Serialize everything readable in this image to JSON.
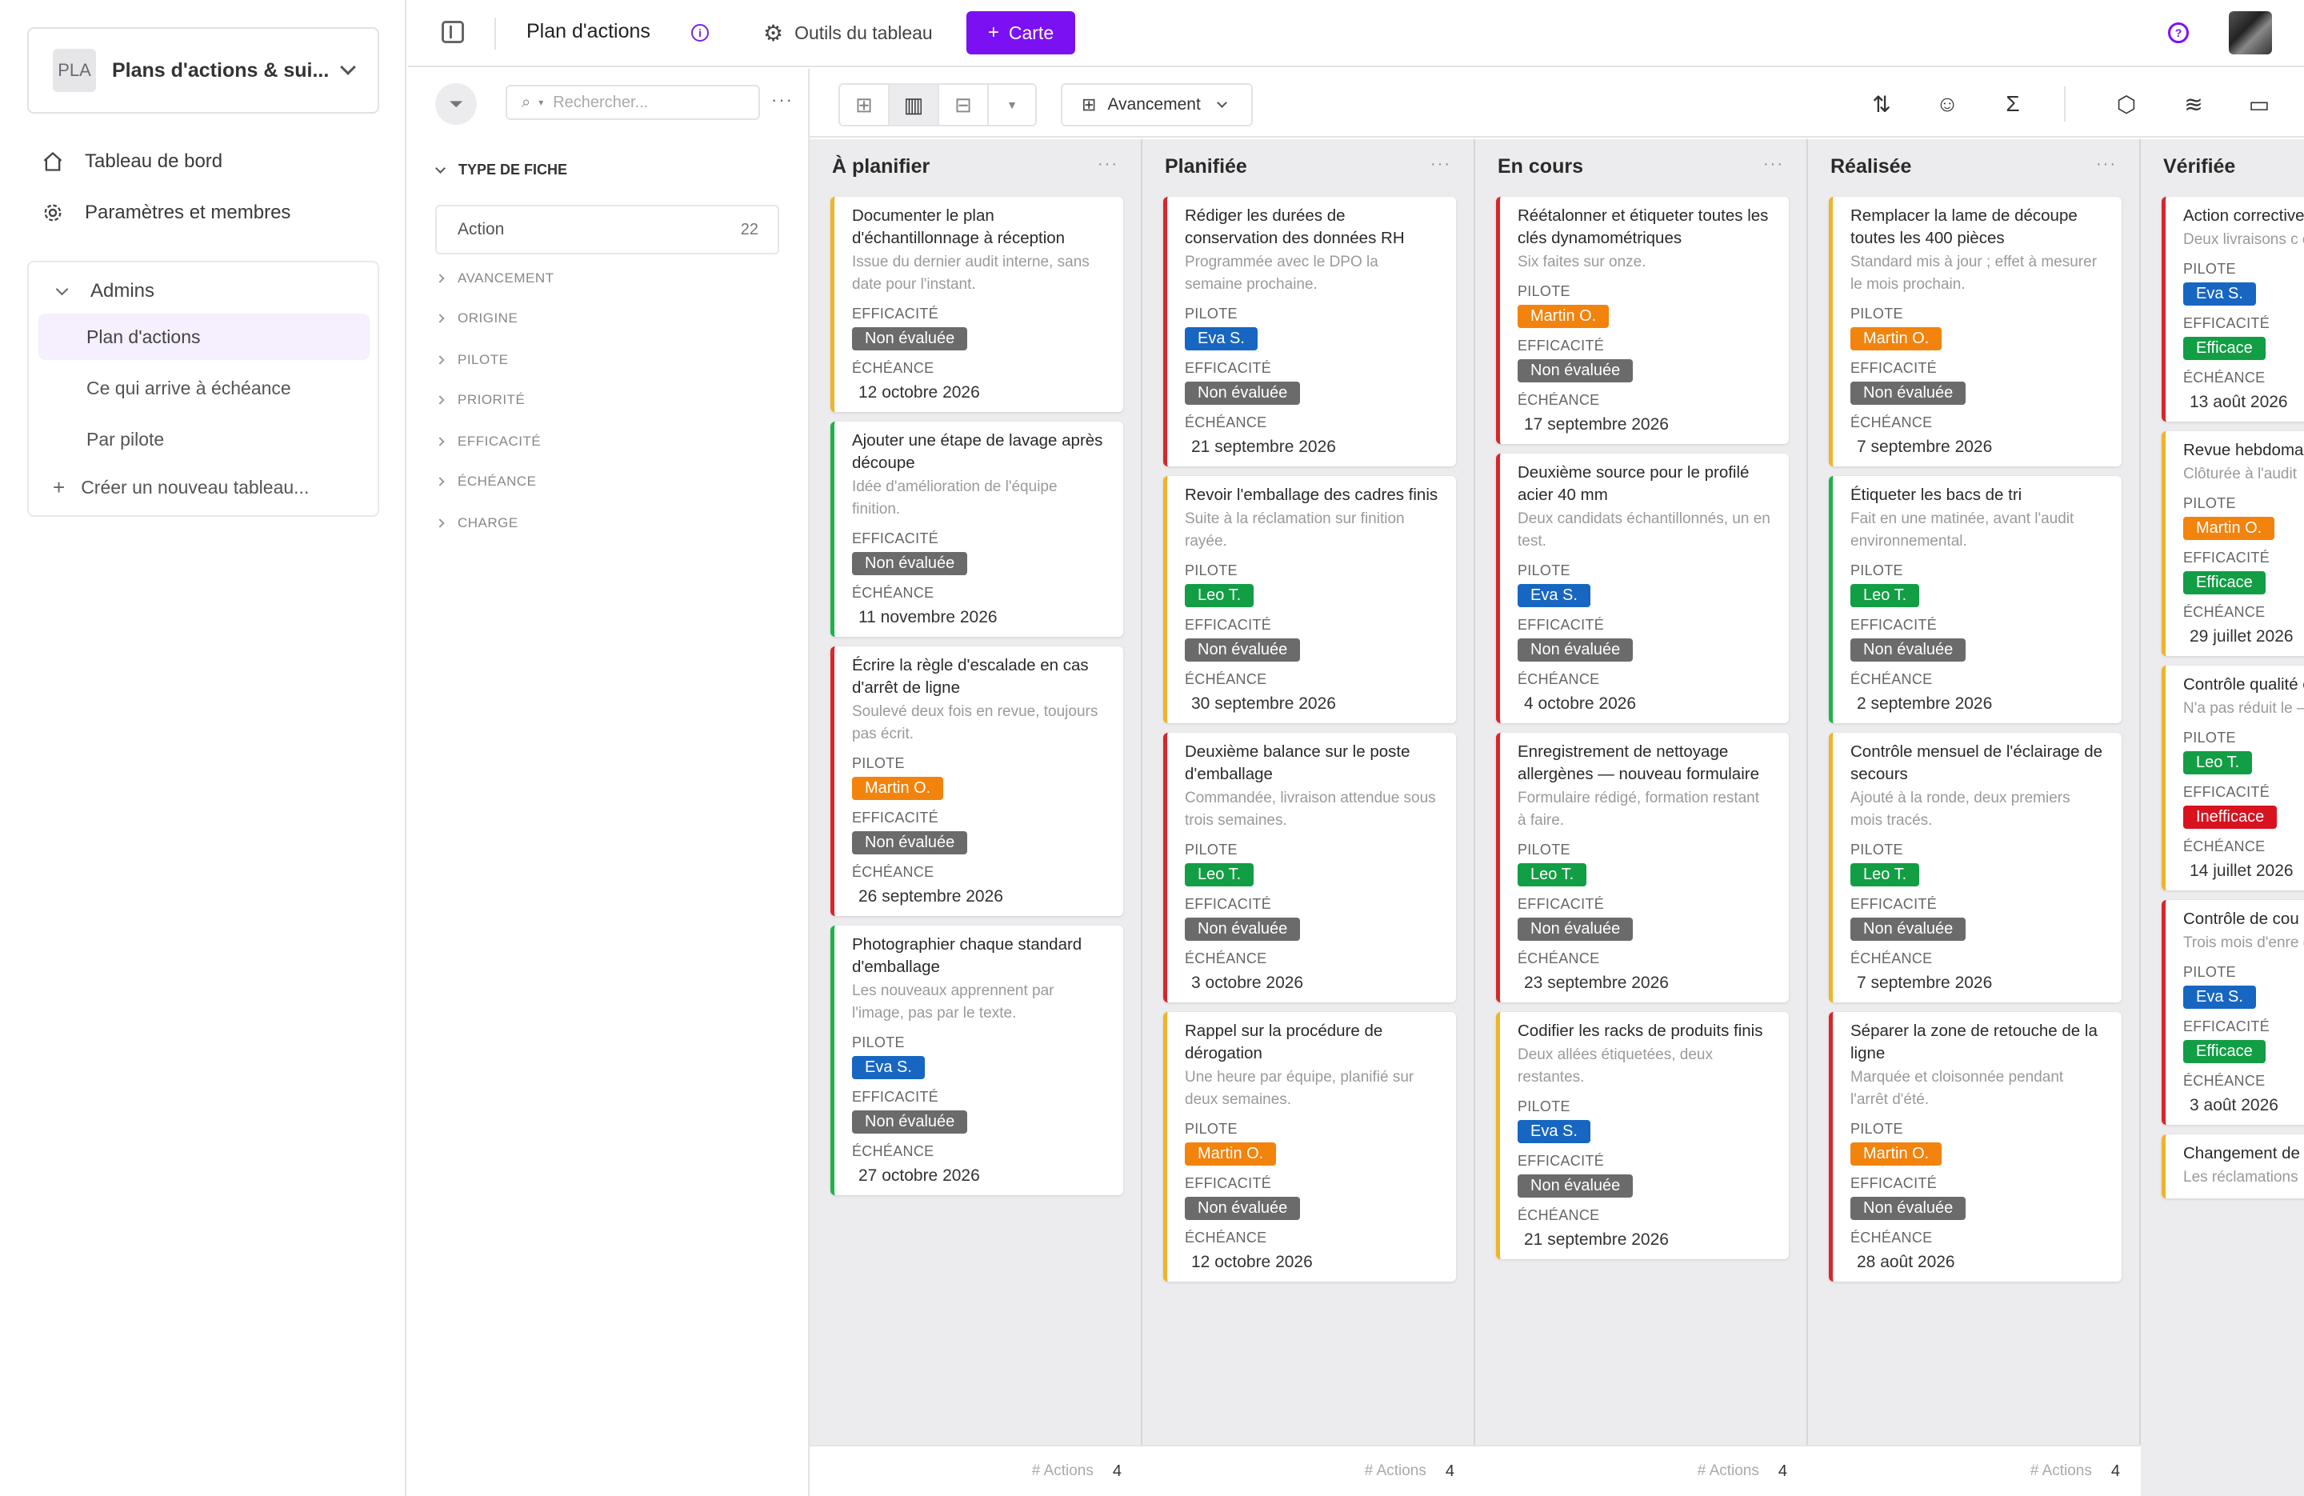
{
  "sidebar": {
    "workspace_initials": "PLA",
    "workspace_name": "Plans d'actions & sui...",
    "dashboard_label": "Tableau de bord",
    "settings_label": "Paramètres et membres",
    "group_label": "Admins",
    "sub_items": [
      "Plan d'actions",
      "Ce qui arrive à échéance",
      "Par pilote"
    ],
    "new_board_label": "Créer un nouveau tableau..."
  },
  "topbar": {
    "title": "Plan d'actions",
    "tools_label": "Outils du tableau",
    "add_card_label": "Carte"
  },
  "filters": {
    "search_placeholder": "Rechercher...",
    "type_head": "TYPE DE FICHE",
    "type_item_label": "Action",
    "type_item_count": "22",
    "facets": [
      "AVANCEMENT",
      "ORIGINE",
      "PILOTE",
      "PRIORITÉ",
      "EFFICACITÉ",
      "ÉCHÉANCE",
      "CHARGE"
    ]
  },
  "toolbar": {
    "group_by_label": "Avancement"
  },
  "labels": {
    "pilote": "PILOTE",
    "efficacite": "EFFICACITÉ",
    "echeance": "ÉCHÉANCE",
    "footer_label": "# Actions"
  },
  "colors": {
    "accent": "#7b11f2",
    "blue": "#1766c2",
    "orange": "#f2830d",
    "green": "#129e44",
    "red": "#d8121e",
    "grey": "#6b6b6b"
  },
  "columns": [
    {
      "name": "À planifier",
      "count": "4",
      "cards": [
        {
          "title": "Documenter le plan d'échantillonnage à réception",
          "desc": "Issue du dernier audit interne, sans date pour l'instant.",
          "pilote": null,
          "efficacite": "Non évaluée",
          "echeance": "12 octobre 2026",
          "bar": "orange"
        },
        {
          "title": "Ajouter une étape de lavage après découpe",
          "desc": "Idée d'amélioration de l'équipe finition.",
          "pilote": null,
          "efficacite": "Non évaluée",
          "echeance": "11 novembre 2026",
          "bar": "green"
        },
        {
          "title": "Écrire la règle d'escalade en cas d'arrêt de ligne",
          "desc": "Soulevé deux fois en revue, toujours pas écrit.",
          "pilote": "Martin O.",
          "efficacite": "Non évaluée",
          "echeance": "26 septembre 2026",
          "bar": "red"
        },
        {
          "title": "Photographier chaque standard d'emballage",
          "desc": "Les nouveaux apprennent par l'image, pas par le texte.",
          "pilote": "Eva S.",
          "efficacite": "Non évaluée",
          "echeance": "27 octobre 2026",
          "bar": "green"
        }
      ]
    },
    {
      "name": "Planifiée",
      "count": "4",
      "cards": [
        {
          "title": "Rédiger les durées de conservation des données RH",
          "desc": "Programmée avec le DPO la semaine prochaine.",
          "pilote": "Eva S.",
          "efficacite": "Non évaluée",
          "echeance": "21 septembre 2026",
          "bar": "red"
        },
        {
          "title": "Revoir l'emballage des cadres finis",
          "desc": "Suite à la réclamation sur finition rayée.",
          "pilote": "Leo T.",
          "efficacite": "Non évaluée",
          "echeance": "30 septembre 2026",
          "bar": "orange"
        },
        {
          "title": "Deuxième balance sur le poste d'emballage",
          "desc": "Commandée, livraison attendue sous trois semaines.",
          "pilote": "Leo T.",
          "efficacite": "Non évaluée",
          "echeance": "3 octobre 2026",
          "bar": "red"
        },
        {
          "title": "Rappel sur la procédure de dérogation",
          "desc": "Une heure par équipe, planifié sur deux semaines.",
          "pilote": "Martin O.",
          "efficacite": "Non évaluée",
          "echeance": "12 octobre 2026",
          "bar": "orange"
        }
      ]
    },
    {
      "name": "En cours",
      "count": "4",
      "cards": [
        {
          "title": "Réétalonner et étiqueter toutes les clés dynamométriques",
          "desc": "Six faites sur onze.",
          "pilote": "Martin O.",
          "efficacite": "Non évaluée",
          "echeance": "17 septembre 2026",
          "bar": "red"
        },
        {
          "title": "Deuxième source pour le profilé acier 40 mm",
          "desc": "Deux candidats échantillonnés, un en test.",
          "pilote": "Eva S.",
          "efficacite": "Non évaluée",
          "echeance": "4 octobre 2026",
          "bar": "red"
        },
        {
          "title": "Enregistrement de nettoyage allergènes — nouveau formulaire",
          "desc": "Formulaire rédigé, formation restant à faire.",
          "pilote": "Leo T.",
          "efficacite": "Non évaluée",
          "echeance": "23 septembre 2026",
          "bar": "red"
        },
        {
          "title": "Codifier les racks de produits finis",
          "desc": "Deux allées étiquetées, deux restantes.",
          "pilote": "Eva S.",
          "efficacite": "Non évaluée",
          "echeance": "21 septembre 2026",
          "bar": "orange"
        }
      ]
    },
    {
      "name": "Réalisée",
      "count": "4",
      "cards": [
        {
          "title": "Remplacer la lame de découpe toutes les 400 pièces",
          "desc": "Standard mis à jour ; effet à mesurer le mois prochain.",
          "pilote": "Martin O.",
          "efficacite": "Non évaluée",
          "echeance": "7 septembre 2026",
          "bar": "orange"
        },
        {
          "title": "Étiqueter les bacs de tri",
          "desc": "Fait en une matinée, avant l'audit environnemental.",
          "pilote": "Leo T.",
          "efficacite": "Non évaluée",
          "echeance": "2 septembre 2026",
          "bar": "green"
        },
        {
          "title": "Contrôle mensuel de l'éclairage de secours",
          "desc": "Ajouté à la ronde, deux premiers mois tracés.",
          "pilote": "Leo T.",
          "efficacite": "Non évaluée",
          "echeance": "7 septembre 2026",
          "bar": "orange"
        },
        {
          "title": "Séparer la zone de retouche de la ligne",
          "desc": "Marquée et cloisonnée pendant l'arrêt d'été.",
          "pilote": "Martin O.",
          "efficacite": "Non évaluée",
          "echeance": "28 août 2026",
          "bar": "red"
        }
      ]
    },
    {
      "name": "Vérifiée",
      "count": "",
      "cards": [
        {
          "title": "Action corrective la dureté des bo",
          "desc": "Deux livraisons c efficace.",
          "pilote": "Eva S.",
          "efficacite": "Efficace",
          "echeance": "13 août 2026",
          "bar": "red"
        },
        {
          "title": "Revue hebdoma nuisibles",
          "desc": "Clôturée à l'audit",
          "pilote": "Martin O.",
          "efficacite": "Efficace",
          "echeance": "29 juillet 2026",
          "bar": "orange"
        },
        {
          "title": "Contrôle qualité en finition",
          "desc": "N'a pas réduit le — rouverte ailleu",
          "pilote": "Leo T.",
          "efficacite": "Inefficace",
          "echeance": "14 juillet 2026",
          "bar": "orange"
        },
        {
          "title": "Contrôle de cou chaque prise de",
          "desc": "Trois mois d'enre de dérive depuis.",
          "pilote": "Eva S.",
          "efficacite": "Efficace",
          "echeance": "3 août 2026",
          "bar": "red"
        },
        {
          "title": "Changement de le film d'emballa",
          "desc": "Les réclamations",
          "pilote": null,
          "efficacite": null,
          "echeance": null,
          "bar": "orange"
        }
      ]
    }
  ]
}
